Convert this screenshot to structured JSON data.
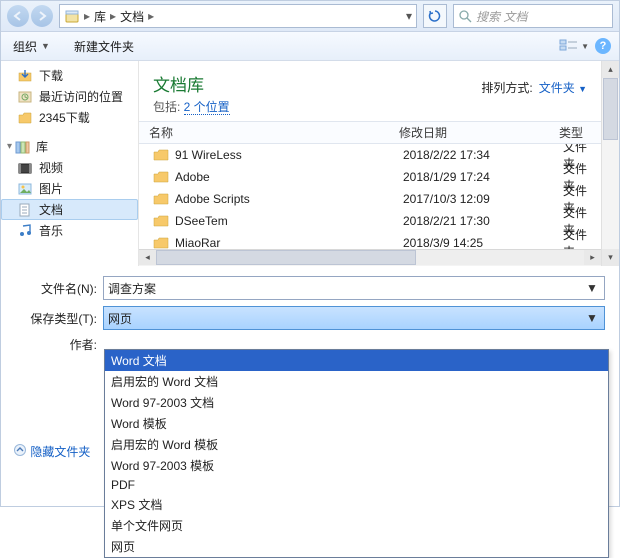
{
  "addr": {
    "path": [
      "库",
      "文档"
    ],
    "search_placeholder": "搜索 文档"
  },
  "toolbar": {
    "organize": "组织",
    "new_folder": "新建文件夹"
  },
  "sidebar": {
    "items": [
      {
        "icon": "download-icon",
        "label": "下载"
      },
      {
        "icon": "recent-icon",
        "label": "最近访问的位置"
      },
      {
        "icon": "folder-icon",
        "label": "2345下载"
      }
    ],
    "lib_label": "库",
    "lib_items": [
      {
        "icon": "video-icon",
        "label": "视频"
      },
      {
        "icon": "picture-icon",
        "label": "图片"
      },
      {
        "icon": "document-icon",
        "label": "文档"
      },
      {
        "icon": "music-icon",
        "label": "音乐"
      }
    ]
  },
  "library": {
    "title": "文档库",
    "subtitle_prefix": "包括: ",
    "subtitle_link": "2 个位置",
    "sort_label": "排列方式:",
    "sort_value": "文件夹"
  },
  "columns": {
    "name": "名称",
    "date": "修改日期",
    "type": "类型"
  },
  "files": [
    {
      "name": "91 WireLess",
      "date": "2018/2/22 17:34",
      "type": "文件夹"
    },
    {
      "name": "Adobe",
      "date": "2018/1/29 17:24",
      "type": "文件夹"
    },
    {
      "name": "Adobe Scripts",
      "date": "2017/10/3 12:09",
      "type": "文件夹"
    },
    {
      "name": "DSeeTem",
      "date": "2018/2/21 17:30",
      "type": "文件夹"
    },
    {
      "name": "MiaoRar",
      "date": "2018/3/9 14:25",
      "type": "文件夹"
    }
  ],
  "form": {
    "filename_label": "文件名(N):",
    "filename_value": "调查方案",
    "type_label": "保存类型(T):",
    "type_value": "网页",
    "author_label": "作者:"
  },
  "dropdown": {
    "options": [
      "Word 文档",
      "启用宏的 Word 文档",
      "Word 97-2003 文档",
      "Word 模板",
      "启用宏的 Word 模板",
      "Word 97-2003 模板",
      "PDF",
      "XPS 文档",
      "单个文件网页",
      "网页"
    ]
  },
  "hide_folders": "隐藏文件夹"
}
